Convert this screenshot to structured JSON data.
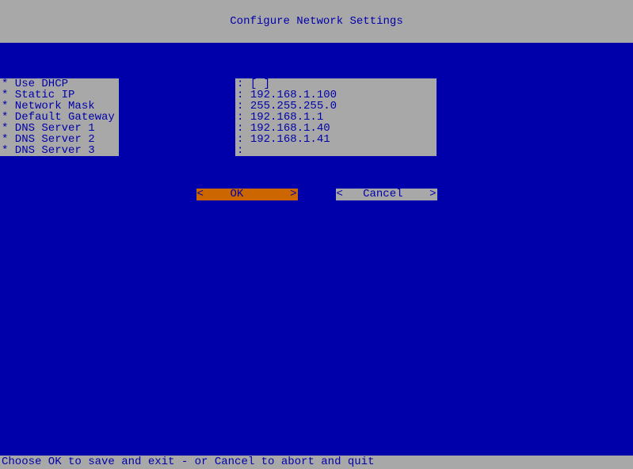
{
  "header": {
    "title": "Configure Network Settings"
  },
  "fields": [
    {
      "label": "* Use DHCP",
      "value": "[ ]"
    },
    {
      "label": "* Static IP",
      "value": "192.168.1.100"
    },
    {
      "label": "* Network Mask",
      "value": "255.255.255.0"
    },
    {
      "label": "* Default Gateway",
      "value": "192.168.1.1"
    },
    {
      "label": "* DNS Server 1",
      "value": "192.168.1.40"
    },
    {
      "label": "* DNS Server 2",
      "value": "192.168.1.41"
    },
    {
      "label": "* DNS Server 3",
      "value": ""
    }
  ],
  "buttons": {
    "ok": "<    OK       >",
    "cancel": "<   Cancel    >"
  },
  "footer": {
    "hint": "Choose OK to save and exit - or Cancel to abort and quit"
  }
}
